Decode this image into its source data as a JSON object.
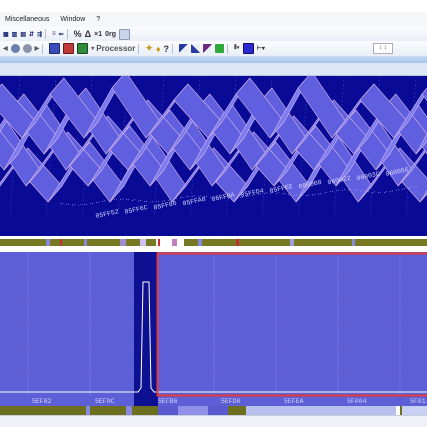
{
  "menu": {
    "items": [
      "Miscellaneous",
      "Window",
      "?"
    ]
  },
  "toolbar": {
    "processor_label": "Processor",
    "spin_value": "↕ ↕"
  },
  "plot3d": {
    "x_tick_labels": [
      "05FF52",
      "05FF6C",
      "05FF86",
      "05FFA0",
      "05FFBA",
      "05FFD4",
      "05FFEE",
      "060008",
      "060022",
      "06003C",
      "060056"
    ]
  },
  "plot2d": {
    "x_tick_labels": [
      "5EF82",
      "5EF9C",
      "5EFB6",
      "5EFD0",
      "5EFEA",
      "5F004",
      "5F01"
    ]
  },
  "colors": {
    "plot3d_bg": "#090a95",
    "plot2d_bg": "#5c5fd6",
    "surface": "#6f6ff0",
    "selection": "#e23a3a",
    "mark_strip": "#777a22"
  }
}
